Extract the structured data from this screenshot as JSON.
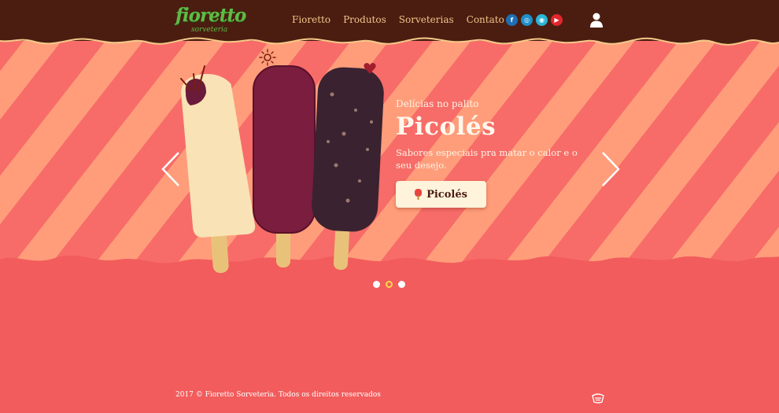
{
  "brand": {
    "name": "fioretto",
    "tagline": "sorveteria"
  },
  "nav": [
    {
      "label": "Fioretto"
    },
    {
      "label": "Produtos"
    },
    {
      "label": "Sorveterias"
    },
    {
      "label": "Contato"
    }
  ],
  "social": [
    {
      "icon": "facebook-icon",
      "glyph": "f",
      "color": "#1e6fb5"
    },
    {
      "icon": "instagram-icon",
      "glyph": "◎",
      "color": "#1e8fc9"
    },
    {
      "icon": "tripadvisor-icon",
      "glyph": "◉",
      "color": "#2cb5d6"
    },
    {
      "icon": "youtube-icon",
      "glyph": "▶",
      "color": "#e2262d"
    }
  ],
  "user_icon": "user-icon",
  "hero": {
    "subtitle": "Delícias no palito",
    "title": "Picolés",
    "description": "Sabores especiais pra matar o calor e o seu desejo.",
    "cta_label": "Picolés",
    "cta_icon": "popsicle-icon",
    "prev_icon": "chevron-left-icon",
    "next_icon": "chevron-right-icon"
  },
  "carousel": {
    "slides": 3,
    "active": 2
  },
  "footer": {
    "copyright": "2017 © Fioretto Sorveteria. Todos os direitos reservados"
  },
  "colors": {
    "header_brown": "#4a1d10",
    "background_red": "#f25c5c",
    "stripe_light": "#ff9d7a",
    "nav_text": "#f2c489",
    "logo_green": "#5dbb46"
  }
}
